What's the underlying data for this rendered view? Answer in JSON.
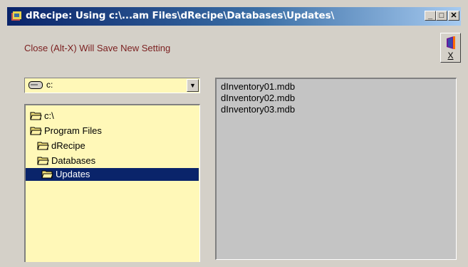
{
  "window": {
    "title": "dRecipe: Using c:\\...am Files\\dRecipe\\Databases\\Updates\\",
    "minimize_glyph": "_",
    "maximize_glyph": "□",
    "close_glyph": "✕"
  },
  "notice": "Close (Alt-X) Will Save New Setting",
  "exit_button": {
    "label": "X"
  },
  "drive": {
    "value": "c:",
    "icon": "drive-icon"
  },
  "directories": [
    {
      "label": "c:\\",
      "selected": false
    },
    {
      "label": "Program Files",
      "selected": false
    },
    {
      "label": "dRecipe",
      "selected": false
    },
    {
      "label": "Databases",
      "selected": false
    },
    {
      "label": "Updates",
      "selected": true
    }
  ],
  "files": [
    "dInventory01.mdb",
    "dInventory02.mdb",
    "dInventory03.mdb"
  ],
  "colors": {
    "titlebar_start": "#0a246a",
    "notice_text": "#7a1e1e",
    "list_background": "#fff8b8",
    "file_list_background": "#c4c4c4",
    "selection": "#0a246a"
  }
}
